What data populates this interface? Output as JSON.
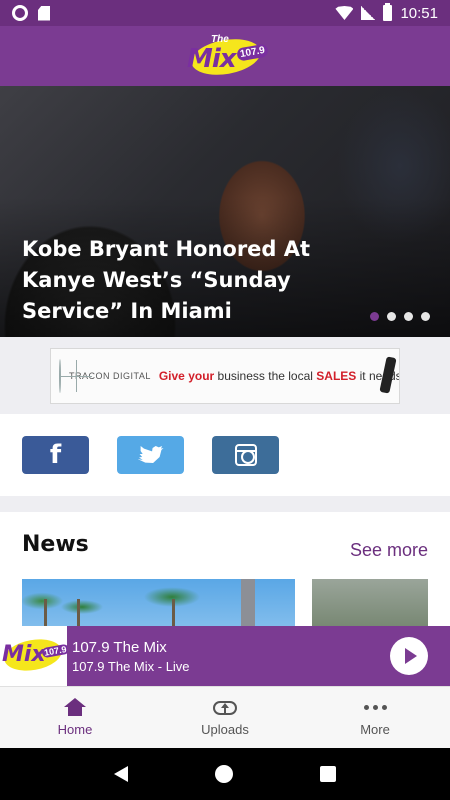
{
  "status_bar": {
    "time": "10:51"
  },
  "app": {
    "logo": {
      "the": "The",
      "mix": "Mix",
      "frequency": "107.9"
    }
  },
  "hero": {
    "title": "Kobe Bryant Honored At Kanye West’s “Sunday Service” In Miami",
    "slide_count": 4,
    "active_slide": 1
  },
  "banner_ad": {
    "brand": "TRACON DIGITAL",
    "slogan_prefix": "Give your",
    "slogan_middle": "business the local",
    "slogan_highlight": "SALES",
    "slogan_suffix": "it needs"
  },
  "social": [
    {
      "name": "facebook",
      "glyph": "f"
    },
    {
      "name": "twitter"
    },
    {
      "name": "instagram"
    }
  ],
  "news": {
    "title": "News",
    "see_more": "See more"
  },
  "player": {
    "logo_text": "Mix",
    "logo_freq": "107.9",
    "title": "107.9 The Mix",
    "subtitle": "107.9 The Mix - Live"
  },
  "bottom_nav": {
    "items": [
      {
        "label": "Home",
        "icon": "home-icon",
        "active": true
      },
      {
        "label": "Uploads",
        "icon": "cloud-upload-icon",
        "active": false
      },
      {
        "label": "More",
        "icon": "more-icon",
        "active": false
      }
    ]
  },
  "colors": {
    "brand_purple": "#7b3b92",
    "status_purple": "#6b2f7e",
    "logo_yellow": "#f5e61c",
    "facebook": "#3a5a98",
    "twitter": "#55a9e6",
    "instagram": "#3d6d99"
  }
}
